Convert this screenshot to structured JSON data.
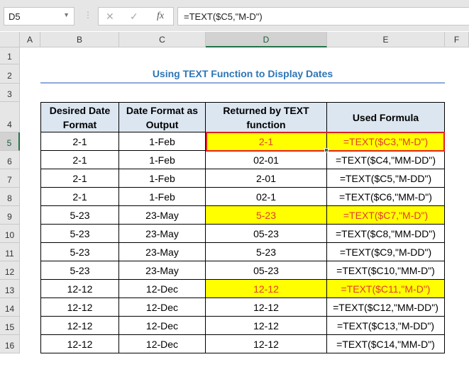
{
  "name_box": "D5",
  "formula": "=TEXT($C5,\"M-D\")",
  "columns": [
    "A",
    "B",
    "C",
    "D",
    "E",
    "F"
  ],
  "rows": [
    "1",
    "2",
    "3",
    "4",
    "5",
    "6",
    "7",
    "8",
    "9",
    "10",
    "11",
    "12",
    "13",
    "14",
    "15",
    "16"
  ],
  "title": "Using TEXT Function to Display Dates",
  "headers": [
    "Desired Date Format",
    "Date Format as Output",
    "Returned by TEXT function",
    "Used Formula"
  ],
  "data": [
    [
      "2-1",
      "1-Feb",
      "2-1",
      "=TEXT($C3,\"M-D\")"
    ],
    [
      "2-1",
      "1-Feb",
      "02-01",
      "=TEXT($C4,\"MM-DD\")"
    ],
    [
      "2-1",
      "1-Feb",
      "2-01",
      "=TEXT($C5,\"M-DD\")"
    ],
    [
      "2-1",
      "1-Feb",
      "02-1",
      "=TEXT($C6,\"MM-D\")"
    ],
    [
      "5-23",
      "23-May",
      "5-23",
      "=TEXT($C7,\"M-D\")"
    ],
    [
      "5-23",
      "23-May",
      "05-23",
      "=TEXT($C8,\"MM-DD\")"
    ],
    [
      "5-23",
      "23-May",
      "5-23",
      "=TEXT($C9,\"M-DD\")"
    ],
    [
      "5-23",
      "23-May",
      "05-23",
      "=TEXT($C10,\"MM-D\")"
    ],
    [
      "12-12",
      "12-Dec",
      "12-12",
      "=TEXT($C11,\"M-D\")"
    ],
    [
      "12-12",
      "12-Dec",
      "12-12",
      "=TEXT($C12,\"MM-DD\")"
    ],
    [
      "12-12",
      "12-Dec",
      "12-12",
      "=TEXT($C13,\"M-DD\")"
    ],
    [
      "12-12",
      "12-Dec",
      "12-12",
      "=TEXT($C14,\"MM-D\")"
    ]
  ],
  "highlighted_rows": [
    0,
    4,
    8
  ]
}
